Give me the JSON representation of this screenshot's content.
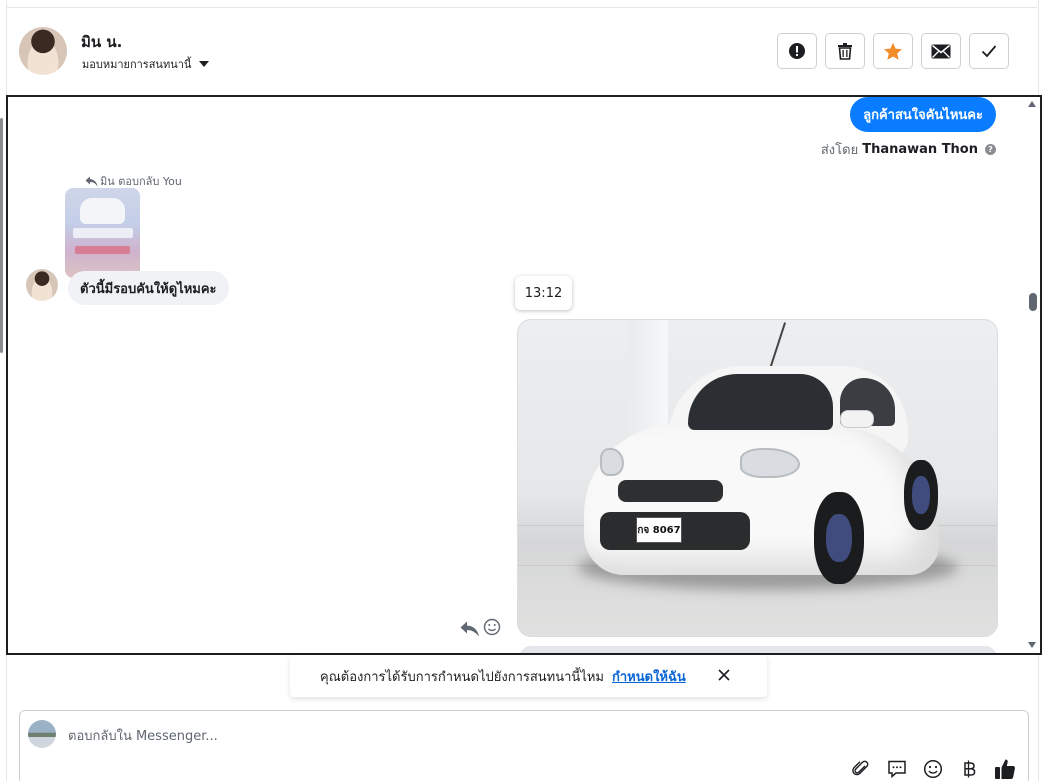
{
  "header": {
    "contact_name": "มิน น.",
    "assign_label": "มอบหมายการสนทนานี้",
    "actions": [
      {
        "name": "report-button",
        "icon": "alert-icon"
      },
      {
        "name": "delete-button",
        "icon": "trash-icon"
      },
      {
        "name": "star-button",
        "icon": "star-icon",
        "color": "#f28c28"
      },
      {
        "name": "mark-unread-button",
        "icon": "envelope-icon"
      },
      {
        "name": "mark-done-button",
        "icon": "check-icon"
      }
    ]
  },
  "messages": {
    "outgoing_text": "ลูกค้าสนใจคันไหนคะ",
    "sent_by_prefix": "ส่งโดย",
    "sent_by_name": "Thanawan Thon",
    "reply_note": "มิน ตอบกลับ You",
    "incoming_text": "ตัวนี้มีรอบคันให้ดูไหมคะ",
    "timestamp": "13:12",
    "plate_text": "กจ 8067"
  },
  "banner": {
    "text": "คุณต้องการได้รับการกำหนดไปยังการสนทนานี้ไหม",
    "link": "กำหนดให้ฉัน"
  },
  "composer": {
    "placeholder": "ตอบกลับใน Messenger...",
    "tools": [
      "paperclip-icon",
      "saved-reply-icon",
      "emoji-icon",
      "baht-icon",
      "thumbs-up-icon"
    ]
  },
  "colors": {
    "accent": "#0a7cff",
    "star": "#f28c28",
    "link": "#0a66d6"
  }
}
